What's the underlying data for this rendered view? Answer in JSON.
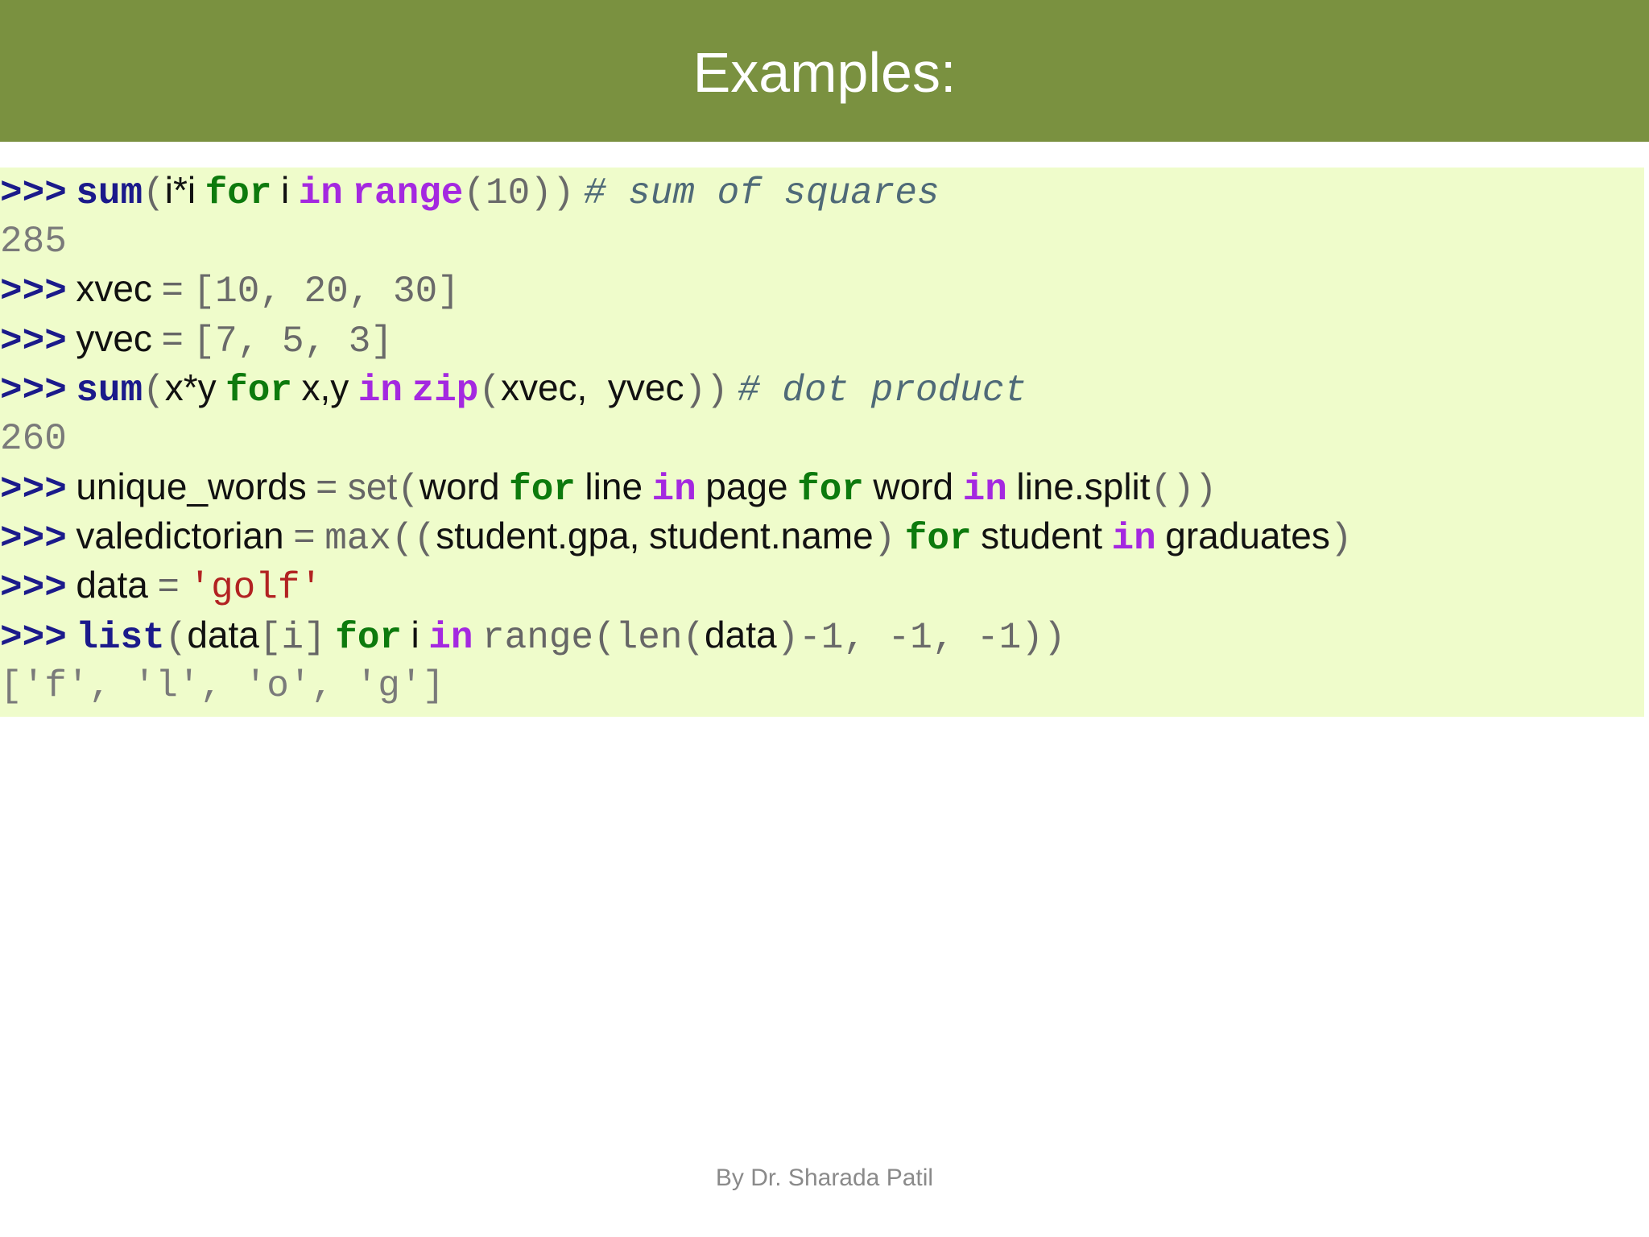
{
  "slide": {
    "title": "Examples:",
    "footer": "By Dr. Sharada Patil",
    "colors": {
      "title_bar": "#7a9140",
      "code_background": "#effccb",
      "prompt": "#1b1a8b",
      "keyword": "#0d7a0d",
      "builtin": "#a428e0",
      "string": "#b22222",
      "comment": "#4f6a78"
    }
  },
  "code": {
    "prompt": ">>>",
    "l1": {
      "fn": "sum",
      "open": "(",
      "expr": "i*i",
      "for": "for",
      "var": "i",
      "in": "in",
      "range": "range",
      "args": "(10))",
      "comment": "# sum of squares"
    },
    "l2": {
      "output": "285"
    },
    "l3": {
      "name": "xvec",
      "eq": "=",
      "value": "[10, 20, 30]"
    },
    "l4": {
      "name": "yvec",
      "eq": "=",
      "value": "[7, 5, 3]"
    },
    "l5": {
      "fn": "sum",
      "open": "(",
      "expr": "x*y",
      "for": "for",
      "vars": "x,y",
      "in": "in",
      "zip": "zip",
      "zopen": "(",
      "args": "xvec,  yvec",
      "close": "))",
      "comment": "# dot product"
    },
    "l6": {
      "output": "260"
    },
    "l7": {
      "name": "unique_words",
      "eq": "= set",
      "open": "(",
      "word": "word",
      "for1": "for",
      "line": "line",
      "in1": "in",
      "page": "page",
      "for2": "for",
      "word2": "word",
      "in2": "in",
      "split": "line.split",
      "close": "())"
    },
    "l8": {
      "name": "valedictorian",
      "eq": "=",
      "max": "max((",
      "a": "student.gpa,",
      "b": "student.name",
      "close1": ")",
      "for": "for",
      "student": "student",
      "in": "in",
      "grads": "graduates",
      "close2": ")"
    },
    "l9": {
      "name": "data",
      "eq": "=",
      "value": "'golf'"
    },
    "l10": {
      "fn": "list",
      "open": "(",
      "data": "data",
      "idx": "[i]",
      "for": "for",
      "var": "i",
      "in": "in",
      "range": "range(len(",
      "data2": "data",
      "args": ")-1, -1, -1))"
    },
    "l11": {
      "output": "['f', 'l', 'o', 'g']"
    }
  }
}
